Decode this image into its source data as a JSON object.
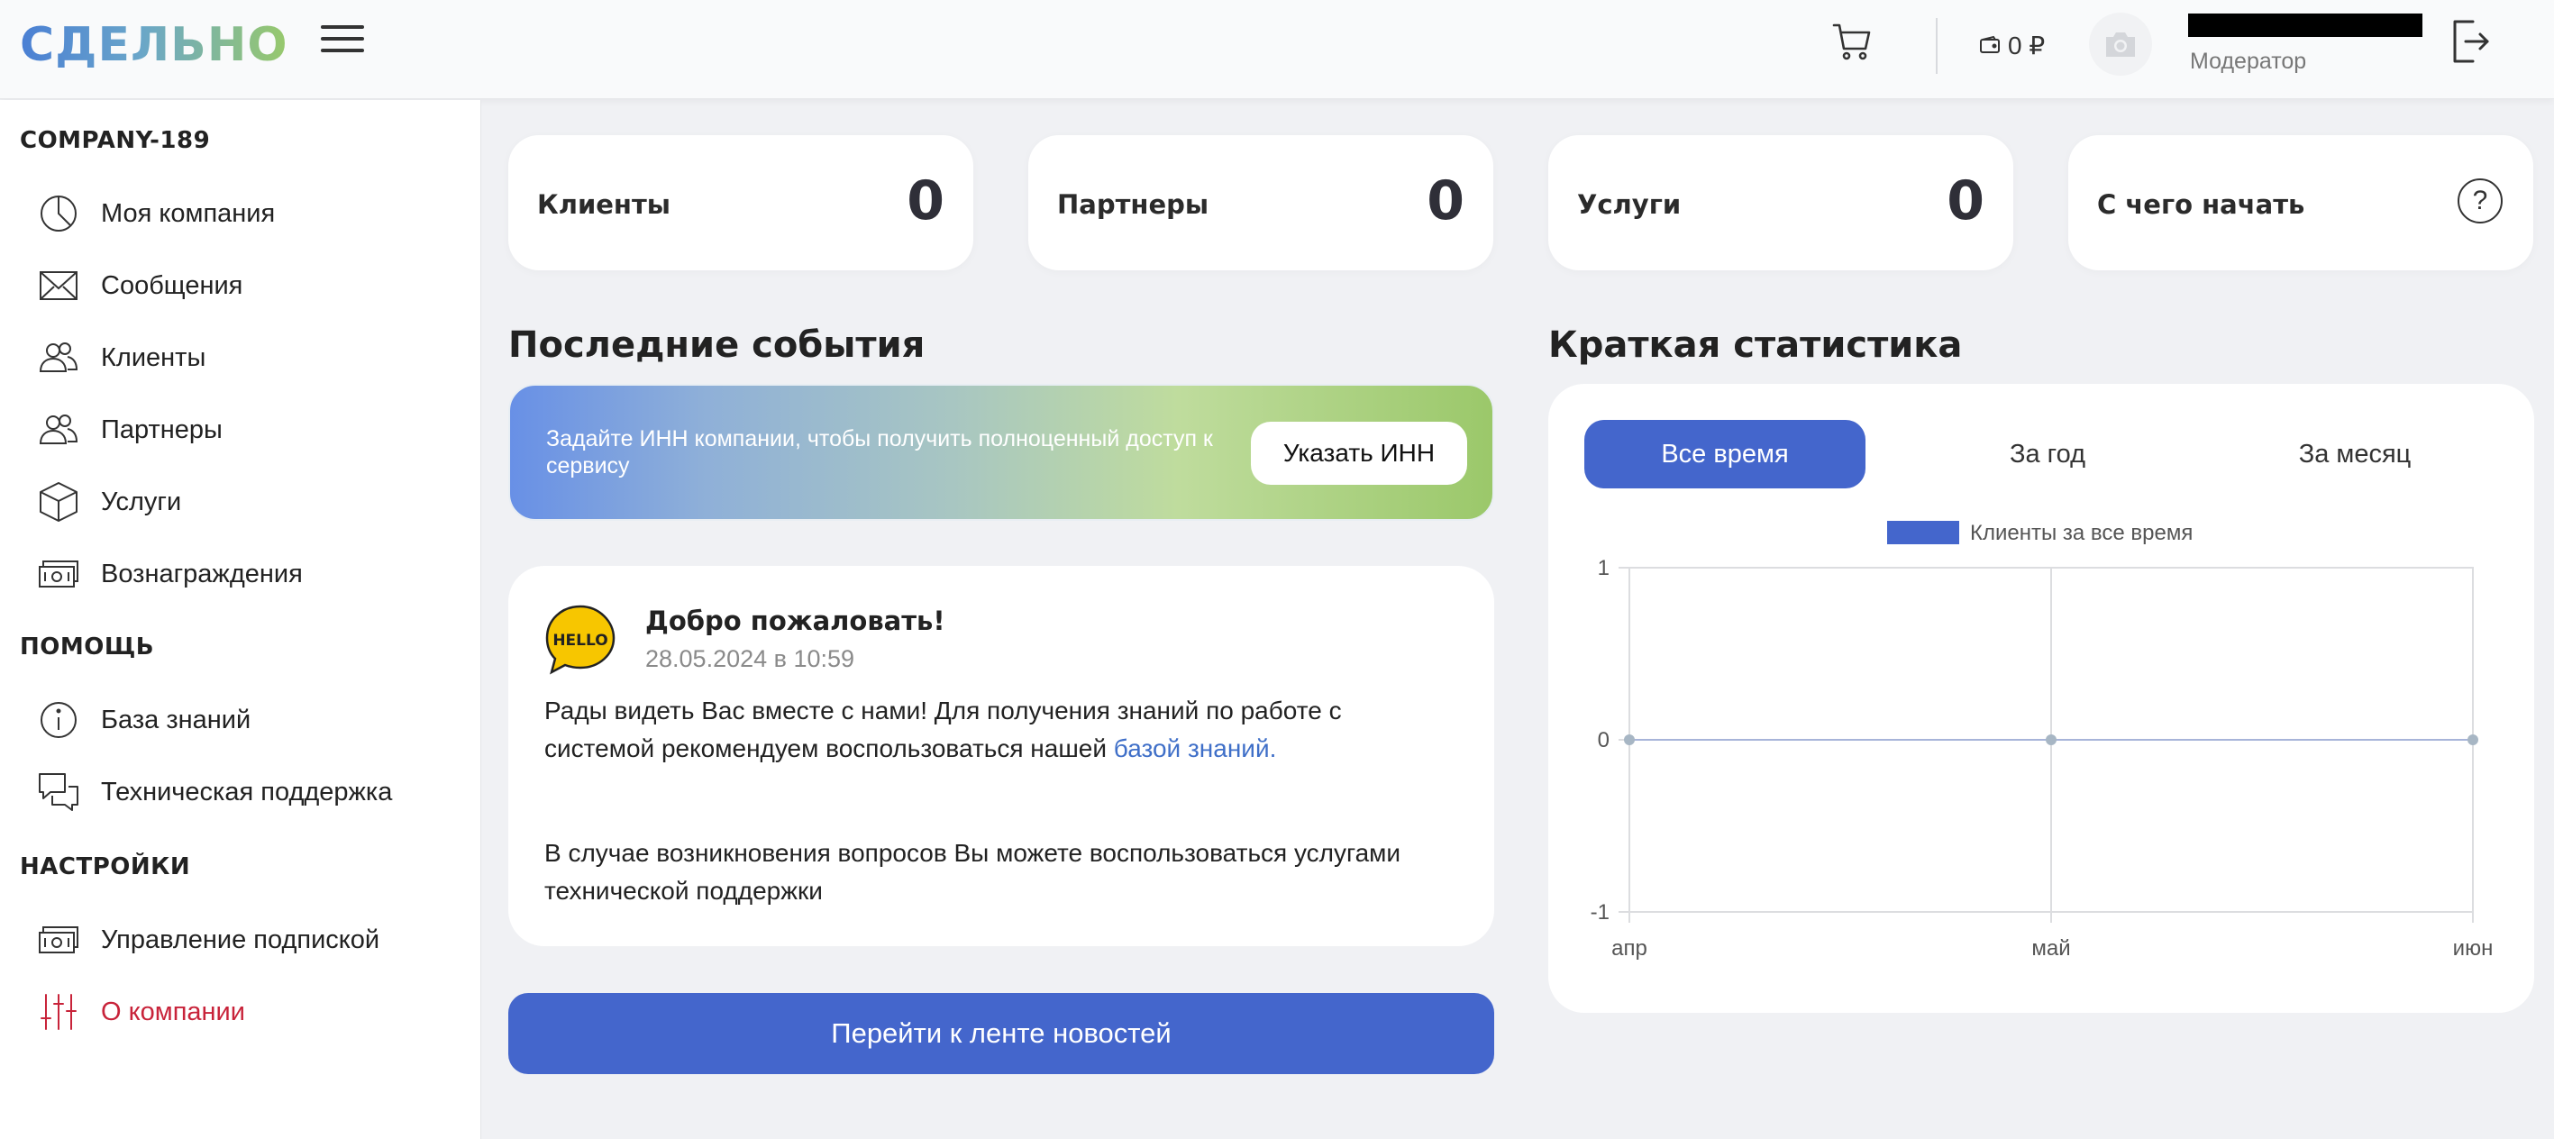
{
  "header": {
    "logo_text": "СДЕЛЬНО",
    "balance": "0 ₽",
    "user_role": "Модератор"
  },
  "sidebar": {
    "company_name": "COMPANY-189",
    "company_items": [
      {
        "label": "Моя компания",
        "icon": "pie-chart-icon"
      },
      {
        "label": "Сообщения",
        "icon": "envelope-icon"
      },
      {
        "label": "Клиенты",
        "icon": "users-icon"
      },
      {
        "label": "Партнеры",
        "icon": "users-icon"
      },
      {
        "label": "Услуги",
        "icon": "box-icon"
      },
      {
        "label": "Вознаграждения",
        "icon": "banknote-icon"
      }
    ],
    "help_title": "ПОМОЩЬ",
    "help_items": [
      {
        "label": "База знаний",
        "icon": "info-icon"
      },
      {
        "label": "Техническая поддержка",
        "icon": "chat-icon"
      }
    ],
    "settings_title": "НАСТРОЙКИ",
    "settings_items": [
      {
        "label": "Управление подпиской",
        "icon": "banknote-icon"
      },
      {
        "label": "О компании",
        "icon": "sliders-icon",
        "active": true
      }
    ]
  },
  "stats": {
    "clients": {
      "label": "Клиенты",
      "value": "0"
    },
    "partners": {
      "label": "Партнеры",
      "value": "0"
    },
    "services": {
      "label": "Услуги",
      "value": "0"
    },
    "start": {
      "label": "С чего начать"
    }
  },
  "events": {
    "title": "Последние события",
    "inn_text": "Задайте ИНН компании, чтобы получить полноценный доступ к сервису",
    "inn_button": "Указать ИНН",
    "welcome_title": "Добро пожаловать!",
    "welcome_date": "28.05.2024 в 10:59",
    "welcome_p1": "Рады видеть Вас вместе с нами! Для получения знаний по работе с системой рекомендуем воспользоваться нашей ",
    "welcome_link": "базой знаний.",
    "welcome_p2": "В случае возникновения вопросов Вы можете воспользоваться услугами технической поддержки",
    "news_button": "Перейти к ленте новостей"
  },
  "statistics": {
    "title": "Краткая статистика",
    "tabs": [
      "Все время",
      "За год",
      "За месяц"
    ],
    "active_tab": 0
  },
  "chart_data": {
    "type": "line",
    "x": [
      "апр",
      "май",
      "июн"
    ],
    "series": [
      {
        "name": "Клиенты за все время",
        "values": [
          0,
          0,
          0
        ],
        "color": "#4466cc"
      }
    ],
    "ylim": [
      -1,
      1
    ],
    "yticks": [
      "1",
      "0",
      "-1"
    ],
    "grid": true,
    "legend": "top"
  },
  "colors": {
    "accent": "#4466cc",
    "active_menu": "#c8233a"
  }
}
